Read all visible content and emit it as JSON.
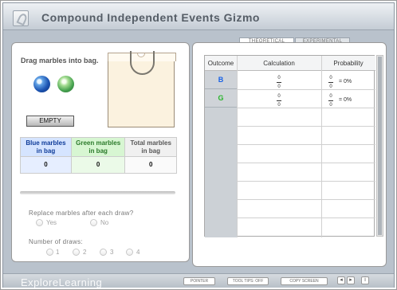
{
  "title": "Compound Independent Events Gizmo",
  "left_panel": {
    "drag_instruction": "Drag marbles into bag.",
    "empty_button": "EMPTY",
    "marbles": [
      "blue-marble",
      "green-marble"
    ],
    "table": {
      "headers": [
        "Blue marbles in bag",
        "Green marbles in bag",
        "Total marbles in bag"
      ],
      "values": [
        "0",
        "0",
        "0"
      ]
    },
    "replace": {
      "label": "Replace marbles after each draw?",
      "options": [
        "Yes",
        "No"
      ]
    },
    "draws": {
      "label": "Number of draws:",
      "options": [
        "1",
        "2",
        "3",
        "4"
      ]
    }
  },
  "tabs": [
    "THEORETICAL",
    "EXPERIMENTAL"
  ],
  "results_table": {
    "headers": [
      "Outcome",
      "Calculation",
      "Probability"
    ],
    "rows": [
      {
        "outcome": "B",
        "numerator": "0",
        "denominator": "0",
        "probability": "= 0%"
      },
      {
        "outcome": "G",
        "numerator": "0",
        "denominator": "0",
        "probability": "= 0%"
      }
    ]
  },
  "footer": {
    "brand": "ExploreLearning",
    "buttons": [
      "POINTER",
      "TOOL TIPS: OFF",
      "COPY SCREEN"
    ]
  },
  "colors": {
    "blue_outcome": "#1761e6",
    "green_outcome": "#28b52a"
  }
}
